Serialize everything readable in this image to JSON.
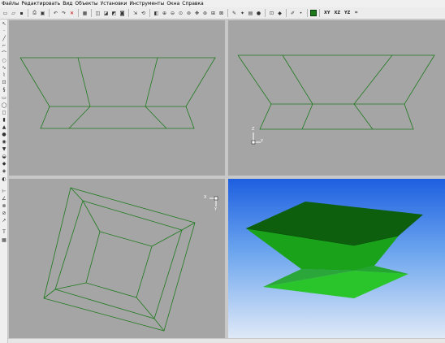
{
  "menu": {
    "items": [
      "Файлы",
      "Редактировать",
      "Вид",
      "Объекты",
      "Установки",
      "Инструменты",
      "Окна",
      "Справка"
    ]
  },
  "toolbar": {
    "icons": [
      "new-file-icon",
      "open-icon",
      "save-icon",
      "print-icon",
      "print-preview-icon",
      "undo-icon",
      "redo-icon",
      "delete-icon",
      "view-icon",
      "view-2-icon",
      "view-3-icon",
      "view-4-icon",
      "select-icon",
      "rotate-icon",
      "render-icon",
      "zoom-in-icon",
      "zoom-out-icon",
      "zoom-window-icon",
      "zoom-all-icon",
      "pan-icon",
      "orbit-icon",
      "zoom-extents-icon",
      "zoom-prev-icon",
      "shade-icon",
      "pick-icon",
      "light-icon",
      "bulb-icon",
      "snap-icon",
      "layer-icon",
      "paint-icon",
      "material-icon",
      "color-swatch-icon"
    ],
    "plane_labels": [
      "XY",
      "XZ",
      "YZ"
    ],
    "color_swatch": "#1c7a1c"
  },
  "viewports": {
    "background_gray": "#a5a5a5",
    "wire_color": "#1e7a1e",
    "axis_top_right": {
      "up": "Z",
      "right": "Y"
    },
    "axis_bottom_left": {
      "left": "X",
      "down": "Y"
    }
  },
  "shaded": {
    "top_face_color": "#0d5f0d",
    "side_color": "#1aa31a",
    "bottom_face_color": "#2ac52a"
  }
}
